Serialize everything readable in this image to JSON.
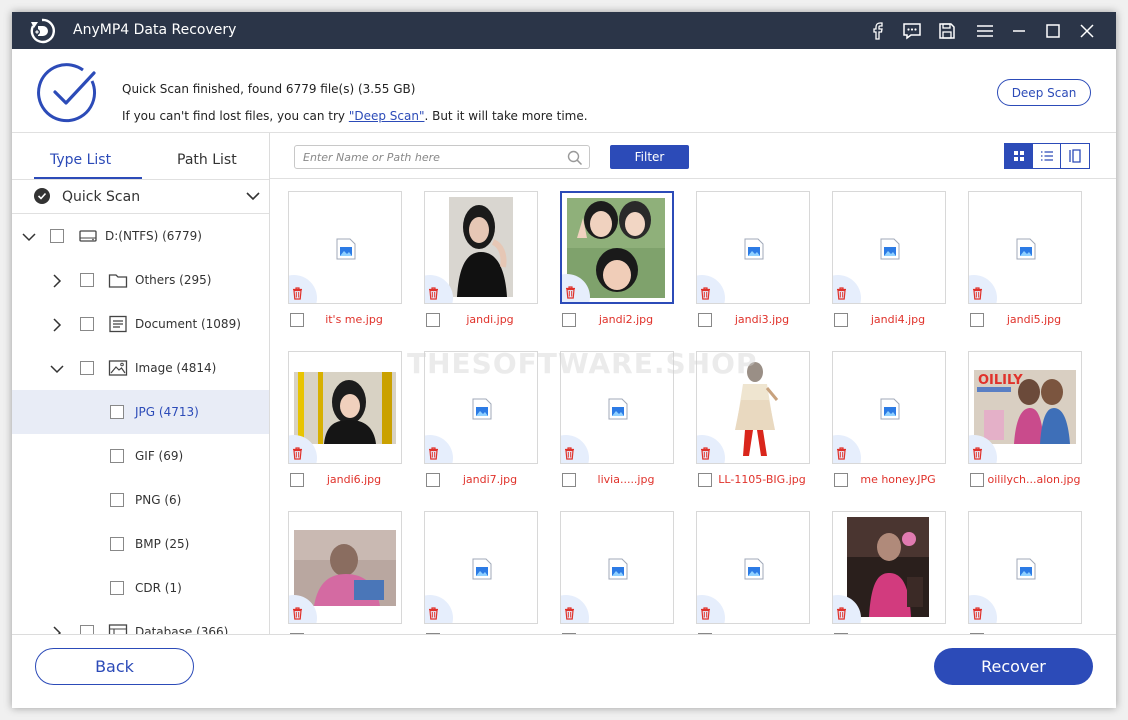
{
  "app": {
    "title": "AnyMP4 Data Recovery"
  },
  "scan": {
    "status": "Quick Scan finished, found 6779 file(s) (3.55 GB)",
    "hint_prefix": "If you can't find lost files, you can try ",
    "hint_link": "\"Deep Scan\"",
    "hint_suffix": ". But it will take more time.",
    "deep_scan_label": "Deep Scan"
  },
  "sidebar": {
    "tabs": [
      {
        "label": "Type List"
      },
      {
        "label": "Path List"
      }
    ],
    "quick_scan_label": "Quick Scan",
    "tree": [
      {
        "label": "D:(NTFS) (6779)",
        "icon": "drive-icon",
        "expanded": true
      },
      {
        "label": "Others (295)",
        "icon": "folder-icon",
        "expanded": false
      },
      {
        "label": "Document (1089)",
        "icon": "document-icon",
        "expanded": false
      },
      {
        "label": "Image (4814)",
        "icon": "image-icon",
        "expanded": true
      },
      {
        "label": "JPG (4713)",
        "selected": true
      },
      {
        "label": "GIF (69)"
      },
      {
        "label": "PNG (6)"
      },
      {
        "label": "BMP (25)"
      },
      {
        "label": "CDR (1)"
      },
      {
        "label": "Database (366)",
        "icon": "database-icon",
        "expanded": false
      }
    ]
  },
  "toolbar": {
    "search_placeholder": "Enter Name or Path here",
    "filter_label": "Filter"
  },
  "files": [
    {
      "name": "it's me.jpg"
    },
    {
      "name": "jandi.jpg"
    },
    {
      "name": "jandi2.jpg"
    },
    {
      "name": "jandi3.jpg"
    },
    {
      "name": "jandi4.jpg"
    },
    {
      "name": "jandi5.jpg"
    },
    {
      "name": "jandi6.jpg"
    },
    {
      "name": "jandi7.jpg"
    },
    {
      "name": "livia.....jpg"
    },
    {
      "name": "LL-1105-BIG.jpg"
    },
    {
      "name": "me honey.JPG"
    },
    {
      "name": "oililych...alon.jpg"
    },
    {
      "name": ""
    },
    {
      "name": ""
    },
    {
      "name": ""
    },
    {
      "name": ""
    },
    {
      "name": ""
    },
    {
      "name": ""
    }
  ],
  "watermark": "THESOFTWARE.SHOP",
  "footer": {
    "back_label": "Back",
    "recover_label": "Recover"
  },
  "colors": {
    "accent": "#2c4bb8",
    "titlebar": "#2b3548",
    "filename": "#e0322b",
    "selected_row": "#e8ecf6"
  }
}
